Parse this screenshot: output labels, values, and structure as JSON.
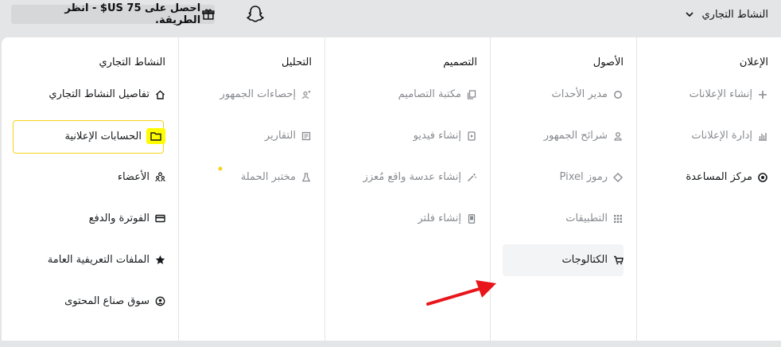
{
  "topbar": {
    "promo_text": "احصل على 75 US$ - انظر الطريقة.",
    "business_select_label": "النشاط التجاري"
  },
  "columns": {
    "ads": {
      "title": "الإعلان",
      "items": [
        "إنشاء الإعلانات",
        "إدارة الإعلانات",
        "مركز المساعدة"
      ]
    },
    "assets": {
      "title": "الأصول",
      "items": [
        "مدير الأحداث",
        "شرائح الجمهور",
        "رموز Pixel",
        "التطبيقات",
        "الكتالوجات"
      ]
    },
    "design": {
      "title": "التصميم",
      "items": [
        "مكتبة التصاميم",
        "إنشاء فيديو",
        "إنشاء عدسة واقع مُعزز",
        "إنشاء فلتر"
      ]
    },
    "analytics": {
      "title": "التحليل",
      "items": [
        "إحصاءات الجمهور",
        "التقارير",
        "مختبر الحملة"
      ]
    },
    "business": {
      "title": "النشاط التجاري",
      "items": [
        "تفاصيل النشاط التجاري",
        "الحسابات الإعلانية",
        "الأعضاء",
        "الفوترة والدفع",
        "الملفات التعريفية العامة",
        "سوق صناع المحتوى"
      ]
    }
  },
  "colors": {
    "accent_yellow": "#fffc00",
    "selected_border": "#f7d21b",
    "annotation_arrow": "#e8161b"
  }
}
